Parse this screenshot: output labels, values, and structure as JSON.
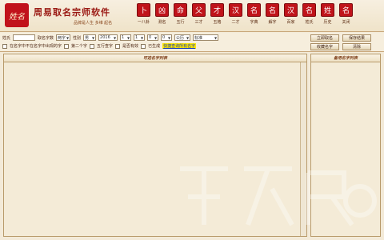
{
  "app": {
    "logo_text": "姓名",
    "title": "周易取名宗师软件",
    "subtitle": "品牌是人生 多维 起名"
  },
  "nav": [
    {
      "glyph": "卜",
      "label": "一八卦"
    },
    {
      "glyph": "凶",
      "label": "测名"
    },
    {
      "glyph": "命",
      "label": "五行"
    },
    {
      "glyph": "父",
      "label": "三才"
    },
    {
      "glyph": "才",
      "label": "五格"
    },
    {
      "glyph": "汉",
      "label": "二才"
    },
    {
      "glyph": "名",
      "label": "字典"
    },
    {
      "glyph": "名",
      "label": "解字"
    },
    {
      "glyph": "汉",
      "label": "百家"
    },
    {
      "glyph": "名",
      "label": "姓氏"
    },
    {
      "glyph": "姓",
      "label": "历史"
    },
    {
      "glyph": "名",
      "label": "关闭"
    }
  ],
  "filters": {
    "row1": {
      "surname_label": "姓氏",
      "surname_value": "",
      "given_label": "取名字数",
      "given_value": "两字",
      "gender_label": "性别",
      "gender_value": "男",
      "year_value": "2016",
      "month_value": "1",
      "day_value": "1",
      "hour_value": "0",
      "minute_value": "0",
      "calendar_value": "公历",
      "mode_value": "标准"
    },
    "row2": {
      "check1_label": "在名字中不在名字中出现的字",
      "check2_label": "第二个字",
      "check3_label": "五行查字",
      "check4_label": "是否有效",
      "check5_label": "已生成",
      "link_label": "快捷查询所有名字"
    }
  },
  "buttons": {
    "generate": "立即取名",
    "save": "保存结果",
    "favorite": "收藏名字",
    "clear": "清除"
  },
  "panels": {
    "left_title": "可选名字列表",
    "right_title": "备用名字列表"
  }
}
